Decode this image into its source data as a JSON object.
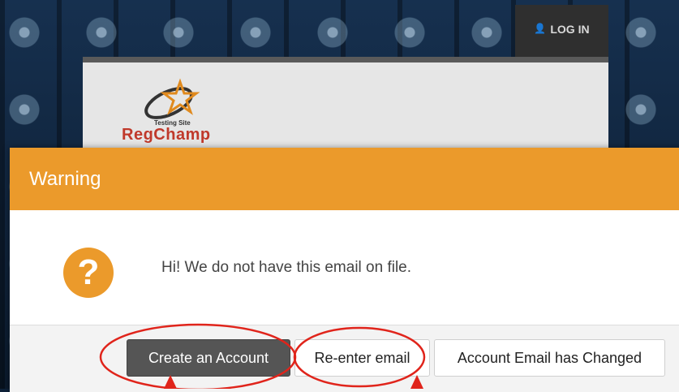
{
  "header": {
    "login_label": "LOG IN",
    "logo_tagline": "Testing Site",
    "logo_brand": "RegChamp"
  },
  "modal": {
    "title": "Warning",
    "message": "Hi! We do not have this email on file.",
    "icon": "question-icon",
    "buttons": {
      "create_account": "Create an Account",
      "reenter_email": "Re-enter email",
      "email_changed": "Account Email has Changed"
    }
  },
  "colors": {
    "accent": "#eb9a2b",
    "primary_button": "#555555",
    "annotation": "#e0241b"
  }
}
